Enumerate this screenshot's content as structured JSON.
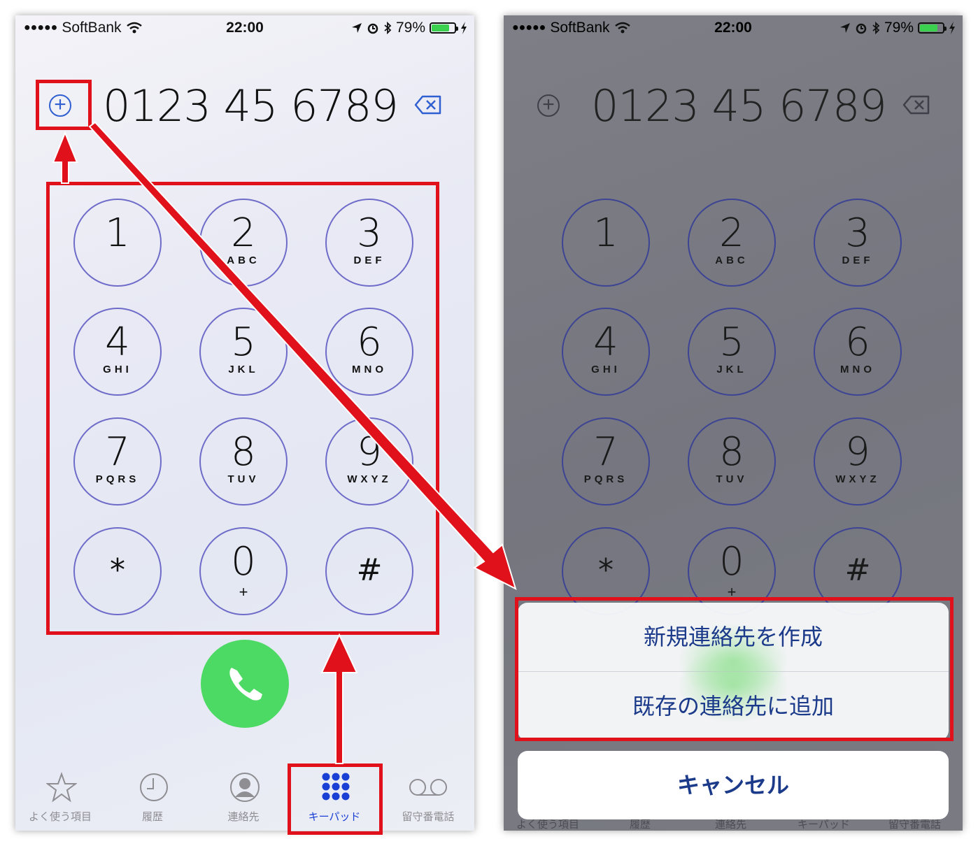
{
  "status_bar": {
    "signal_dots": "●●●●●",
    "carrier": "SoftBank",
    "time": "22:00",
    "battery_percent": "79%",
    "battery_level": 0.79
  },
  "dialer": {
    "number": "0123 45 6789",
    "add_icon": "plus-circle-icon",
    "backspace_icon": "backspace-icon"
  },
  "keypad": [
    {
      "digit": "1",
      "letters": ""
    },
    {
      "digit": "2",
      "letters": "ABC"
    },
    {
      "digit": "3",
      "letters": "DEF"
    },
    {
      "digit": "4",
      "letters": "GHI"
    },
    {
      "digit": "5",
      "letters": "JKL"
    },
    {
      "digit": "6",
      "letters": "MNO"
    },
    {
      "digit": "7",
      "letters": "PQRS"
    },
    {
      "digit": "8",
      "letters": "TUV"
    },
    {
      "digit": "9",
      "letters": "WXYZ"
    },
    {
      "digit": "*",
      "letters": ""
    },
    {
      "digit": "0",
      "letters": "+"
    },
    {
      "digit": "#",
      "letters": ""
    }
  ],
  "tabs": [
    {
      "label": "よく使う項目",
      "icon": "star-icon"
    },
    {
      "label": "履歴",
      "icon": "clock-icon"
    },
    {
      "label": "連絡先",
      "icon": "contacts-icon"
    },
    {
      "label": "キーパッド",
      "icon": "keypad-icon",
      "active": true
    },
    {
      "label": "留守番電話",
      "icon": "voicemail-icon"
    }
  ],
  "action_sheet": {
    "create_new_contact": "新規連絡先を作成",
    "add_to_existing": "既存の連絡先に追加",
    "cancel": "キャンセル"
  },
  "colors": {
    "annotation_red": "#e0111a",
    "call_green": "#4cd964",
    "ios_blue": "#1a3fd4"
  }
}
